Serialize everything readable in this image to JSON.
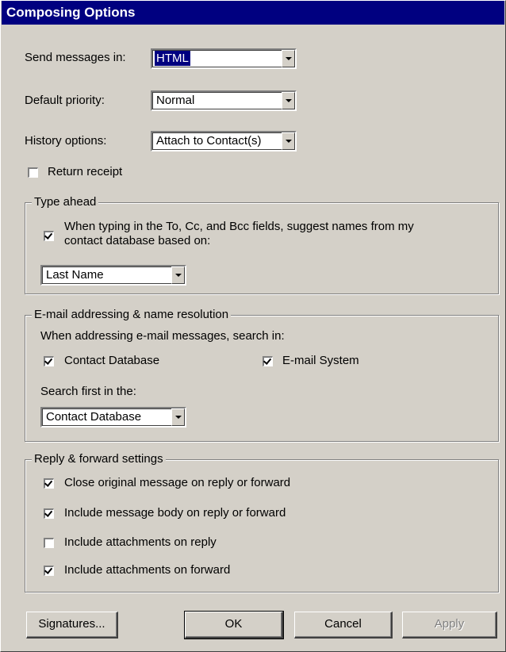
{
  "window": {
    "title": "Composing Options"
  },
  "send_messages": {
    "label": "Send messages in:",
    "value": "HTML"
  },
  "default_priority": {
    "label": "Default priority:",
    "value": "Normal"
  },
  "history_options": {
    "label": "History options:",
    "value": "Attach to Contact(s)"
  },
  "return_receipt": {
    "label": "Return receipt",
    "checked": false
  },
  "type_ahead": {
    "title": "Type ahead",
    "suggest_line1": "When typing in the To, Cc, and Bcc fields, suggest names from my",
    "suggest_line2": "contact database based on:",
    "suggest_checked": true,
    "field_value": "Last Name"
  },
  "addressing": {
    "title": "E-mail addressing & name resolution",
    "search_in_label": "When addressing e-mail messages, search in:",
    "contact_database": {
      "label": "Contact Database",
      "checked": true
    },
    "email_system": {
      "label": "E-mail System",
      "checked": true
    },
    "search_first_label": "Search first in the:",
    "search_first_value": "Contact Database"
  },
  "reply_forward": {
    "title": "Reply & forward settings",
    "items": [
      {
        "label": "Close original message on reply or forward",
        "checked": true
      },
      {
        "label": "Include message body on reply or forward",
        "checked": true
      },
      {
        "label": "Include attachments on reply",
        "checked": false
      },
      {
        "label": "Include attachments on forward",
        "checked": true
      }
    ]
  },
  "buttons": {
    "signatures": "Signatures...",
    "ok": "OK",
    "cancel": "Cancel",
    "apply": "Apply"
  }
}
